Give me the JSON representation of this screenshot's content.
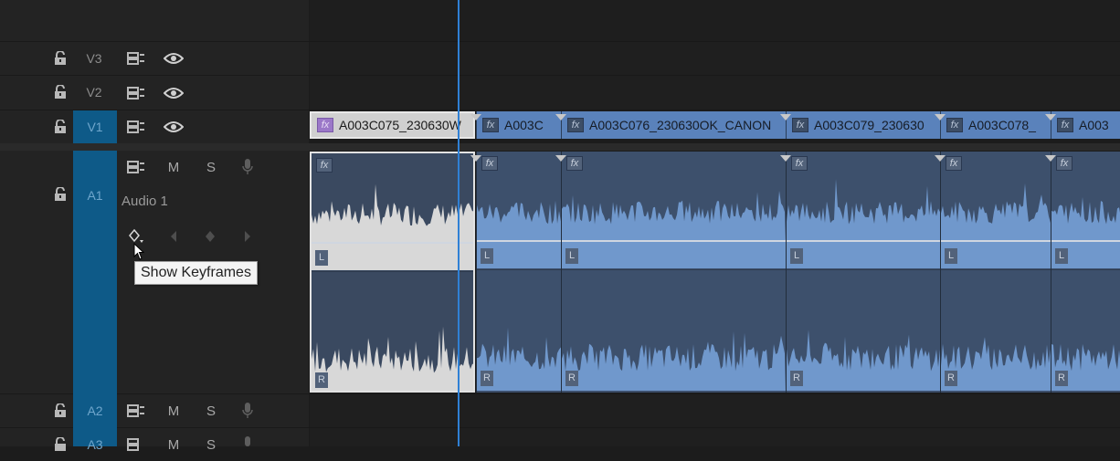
{
  "tracks": {
    "video": [
      {
        "label": "V3",
        "selected": false
      },
      {
        "label": "V2",
        "selected": false
      },
      {
        "label": "V1",
        "selected": true
      }
    ],
    "audio": [
      {
        "label": "A1",
        "selected": true,
        "name": "Audio 1",
        "mute": "M",
        "solo": "S"
      },
      {
        "label": "A2",
        "selected": true,
        "mute": "M",
        "solo": "S"
      },
      {
        "label": "A3",
        "selected": true,
        "mute": "M",
        "solo": "S"
      }
    ]
  },
  "clips": {
    "fx_label": "fx",
    "video": [
      {
        "name": "A003C075_230630W"
      },
      {
        "name": "A003C"
      },
      {
        "name": "A003C076_230630OK_CANON"
      },
      {
        "name": "A003C079_230630"
      },
      {
        "name": "A003C078_"
      },
      {
        "name": "A003"
      }
    ],
    "channel_left": "L",
    "channel_right": "R"
  },
  "tooltip": {
    "text": "Show Keyframes"
  },
  "colors": {
    "playhead": "#2f80d5",
    "selected_track": "#0e5a88",
    "clip_video": "#5a82bb",
    "clip_audio_bg": "#3d506c",
    "waveform": "#7098cc",
    "selected_clip_waveform": "#d8d8d8"
  },
  "icons": [
    "lock-icon",
    "sync-lock-icon",
    "eye-icon",
    "microphone-icon",
    "keyframe-diamond-icon",
    "prev-keyframe-icon",
    "next-keyframe-icon",
    "mouse-cursor-icon"
  ]
}
